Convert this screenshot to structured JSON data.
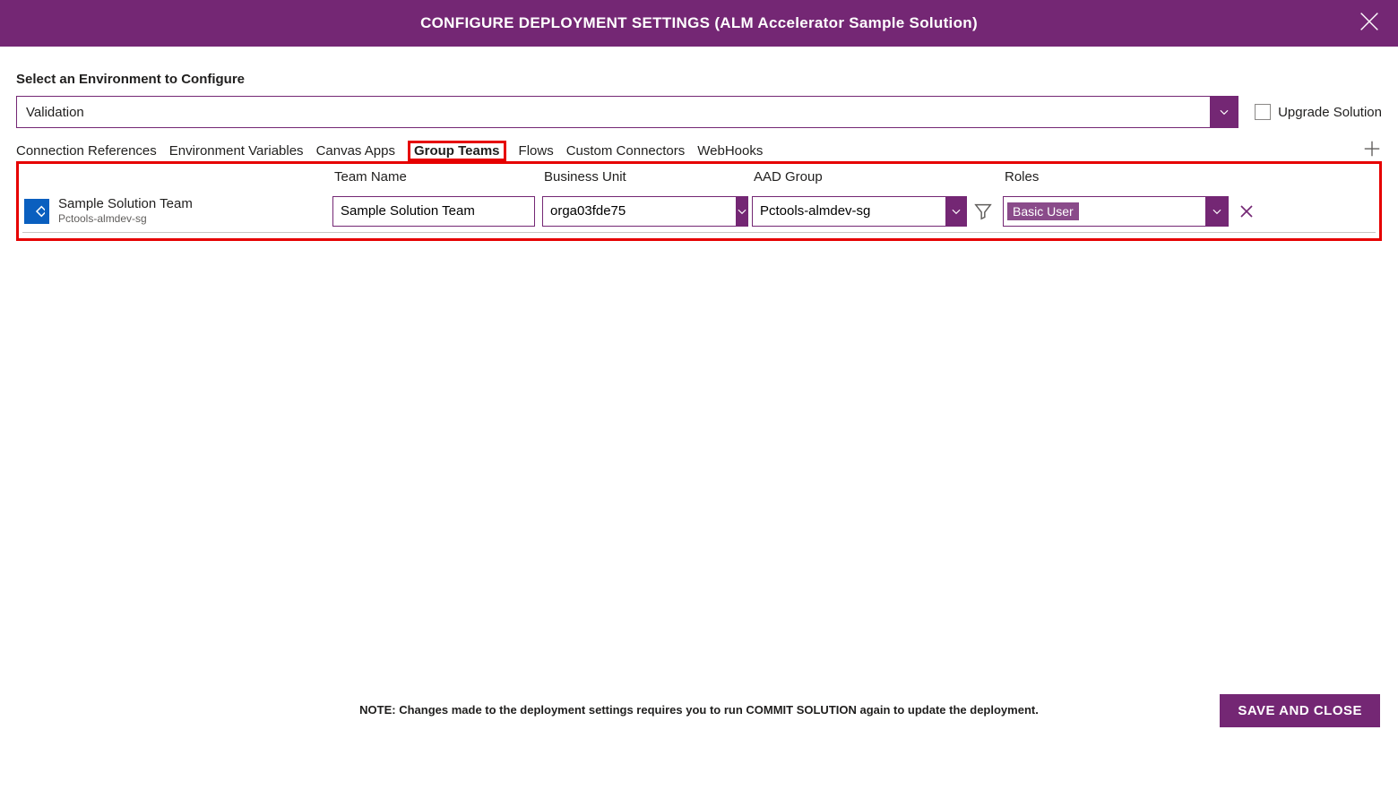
{
  "header": {
    "title": "CONFIGURE DEPLOYMENT SETTINGS (ALM Accelerator Sample Solution)"
  },
  "section_label": "Select an Environment to Configure",
  "environment": {
    "value": "Validation"
  },
  "upgrade_checkbox_label": "Upgrade Solution",
  "tabs": [
    "Connection References",
    "Environment Variables",
    "Canvas Apps",
    "Group Teams",
    "Flows",
    "Custom Connectors",
    "WebHooks"
  ],
  "active_tab": "Group Teams",
  "columns": {
    "team_name": "Team Name",
    "business_unit": "Business Unit",
    "aad_group": "AAD Group",
    "roles": "Roles"
  },
  "rows": [
    {
      "display_name": "Sample Solution Team",
      "display_sub": "Pctools-almdev-sg",
      "team_name": "Sample Solution Team",
      "business_unit": "orga03fde75",
      "aad_group": "Pctools-almdev-sg",
      "role": "Basic User"
    }
  ],
  "note": "NOTE: Changes made to the deployment settings requires you to run COMMIT SOLUTION again to update the deployment.",
  "save_button": "SAVE AND CLOSE"
}
